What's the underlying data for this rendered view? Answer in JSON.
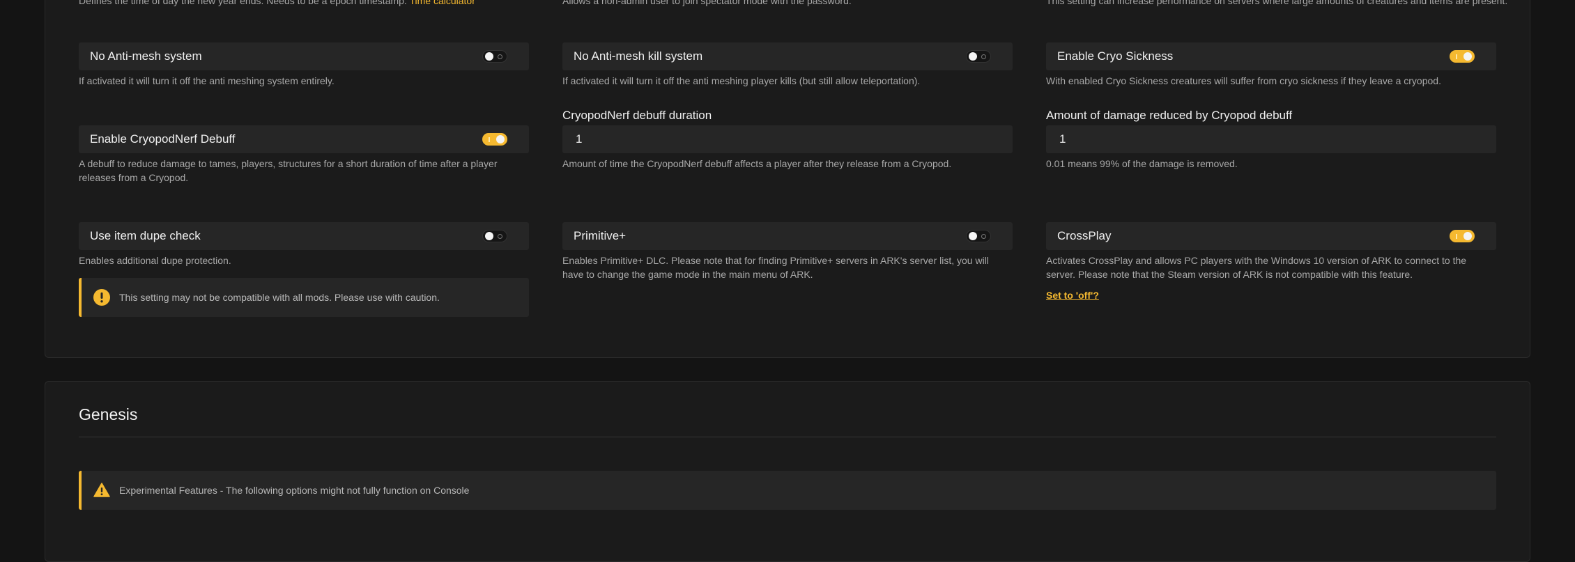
{
  "top_descs": {
    "col1_prefix": "Defines the time of day the new year ends. Needs to be a epoch timestamp.",
    "col1_link": "Time calculator",
    "col2": "Allows a non-admin user to join spectator mode with the password.",
    "col3": "This setting can increase performance on servers where large amounts of creatures and items are present."
  },
  "settings": {
    "no_antimesh": {
      "label": "No Anti-mesh system",
      "enabled": false,
      "desc": "If activated it will turn it off the anti meshing system entirely."
    },
    "no_antimesh_kill": {
      "label": "No Anti-mesh kill system",
      "enabled": false,
      "desc": "If activated it will turn it off the anti meshing player kills (but still allow teleportation)."
    },
    "cryo_sickness": {
      "label": "Enable Cryo Sickness",
      "enabled": true,
      "desc": "With enabled Cryo Sickness creatures will suffer from cryo sickness if they leave a cryopod."
    },
    "cryopodnerf_debuff": {
      "label": "Enable CryopodNerf Debuff",
      "enabled": true,
      "desc": "A debuff to reduce damage to tames, players, structures for a short duration of time after a player releases from a Cryopod."
    },
    "cryopodnerf_duration": {
      "label": "CryopodNerf debuff duration",
      "value": "1",
      "desc": "Amount of time the CryopodNerf debuff affects a player after they release from a Cryopod."
    },
    "cryopod_damage_reduced": {
      "label": "Amount of damage reduced by Cryopod debuff",
      "value": "1",
      "desc": "0.01 means 99% of the damage is removed."
    },
    "item_dupe_check": {
      "label": "Use item dupe check",
      "enabled": false,
      "desc": "Enables additional dupe protection.",
      "warning": "This setting may not be compatible with all mods. Please use with caution."
    },
    "primitive_plus": {
      "label": "Primitive+",
      "enabled": false,
      "desc": "Enables Primitive+ DLC. Please note that for finding Primitive+ servers in ARK's server list, you will have to change the game mode in the main menu of ARK."
    },
    "crossplay": {
      "label": "CrossPlay",
      "enabled": true,
      "desc": "Activates CrossPlay and allows PC players with the Windows 10 version of ARK to connect to the server. Please note that the Steam version of ARK is not compatible with this feature.",
      "action": "Set to 'off'?"
    }
  },
  "genesis": {
    "title": "Genesis",
    "alert": "Experimental Features - The following options might not fully function on Console"
  },
  "colors": {
    "accent": "#f5b930",
    "background": "#141414",
    "panel": "#1b1b1b",
    "field": "#262626"
  },
  "icons": {
    "warning_circle": "exclamation-circle-icon",
    "warning_triangle": "warning-triangle-icon"
  }
}
